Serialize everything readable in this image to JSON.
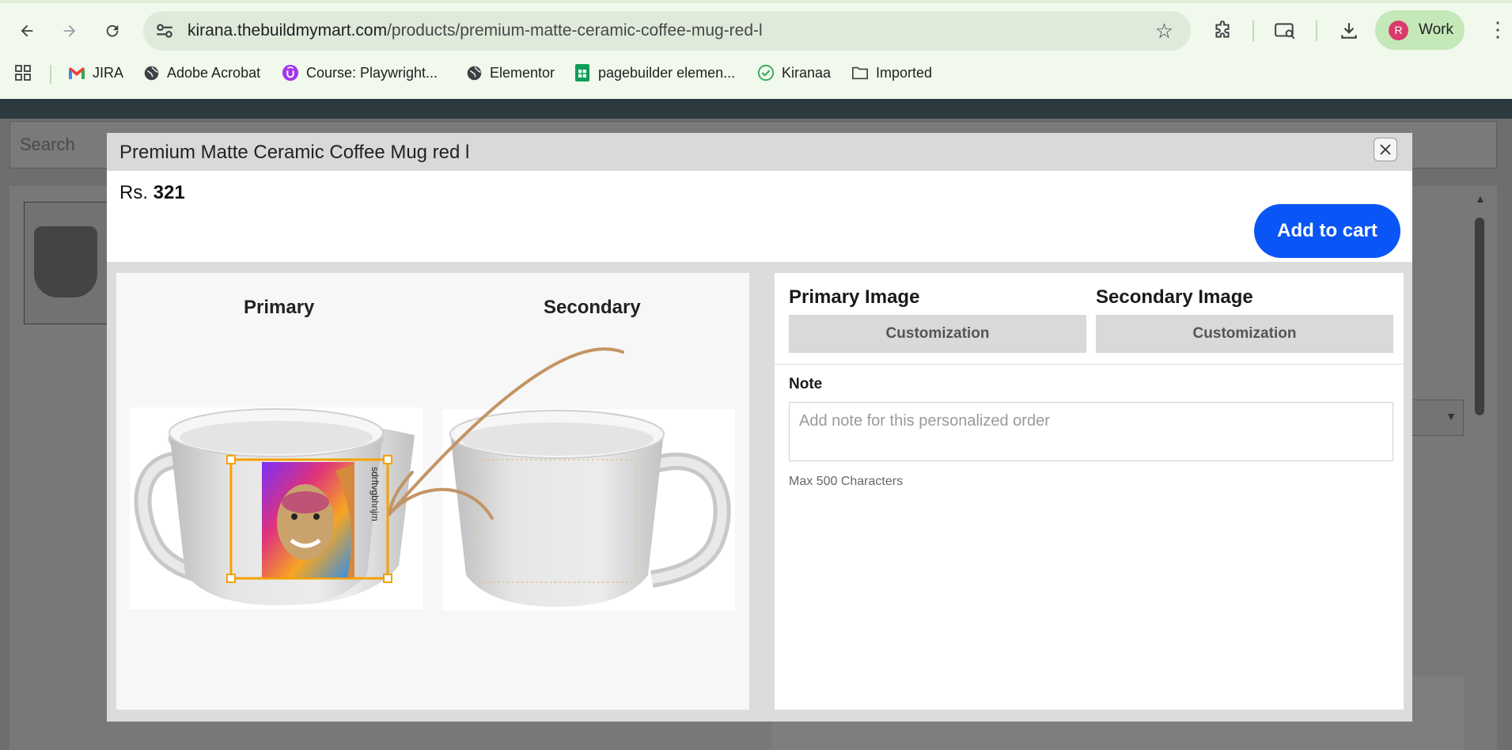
{
  "browser": {
    "url_host": "kirana.thebuildmymart.com",
    "url_path": "/products/premium-matte-ceramic-coffee-mug-red-l",
    "profile_initial": "R",
    "profile_name": "Work"
  },
  "bookmarks": [
    {
      "label": "JIRA",
      "icon": "gmail-icon"
    },
    {
      "label": "Adobe Acrobat",
      "icon": "globe-icon"
    },
    {
      "label": "Course: Playwright...",
      "icon": "udemy-icon"
    },
    {
      "label": "Elementor",
      "icon": "globe-icon"
    },
    {
      "label": "pagebuilder elemen...",
      "icon": "sheets-icon"
    },
    {
      "label": "Kiranaa",
      "icon": "check-icon"
    },
    {
      "label": "Imported",
      "icon": "folder-icon"
    }
  ],
  "page": {
    "search_placeholder": "Search"
  },
  "modal": {
    "title": "Premium Matte Ceramic Coffee Mug red l",
    "price_prefix": "Rs.",
    "price_value": "321",
    "add_to_cart": "Add to cart",
    "preview": {
      "primary_label": "Primary",
      "secondary_label": "Secondary",
      "sticker_text": "sdrftvgbhnjm"
    },
    "form": {
      "primary_heading": "Primary Image",
      "secondary_heading": "Secondary Image",
      "primary_button": "Customization",
      "secondary_button": "Customization",
      "note_label": "Note",
      "note_placeholder": "Add note for this personalized order",
      "note_value": "",
      "max_chars": "Max 500 Characters"
    }
  },
  "colors": {
    "accent_button": "#0a55f5",
    "selection_outline": "#f5a100",
    "arrow": "#c39465"
  }
}
